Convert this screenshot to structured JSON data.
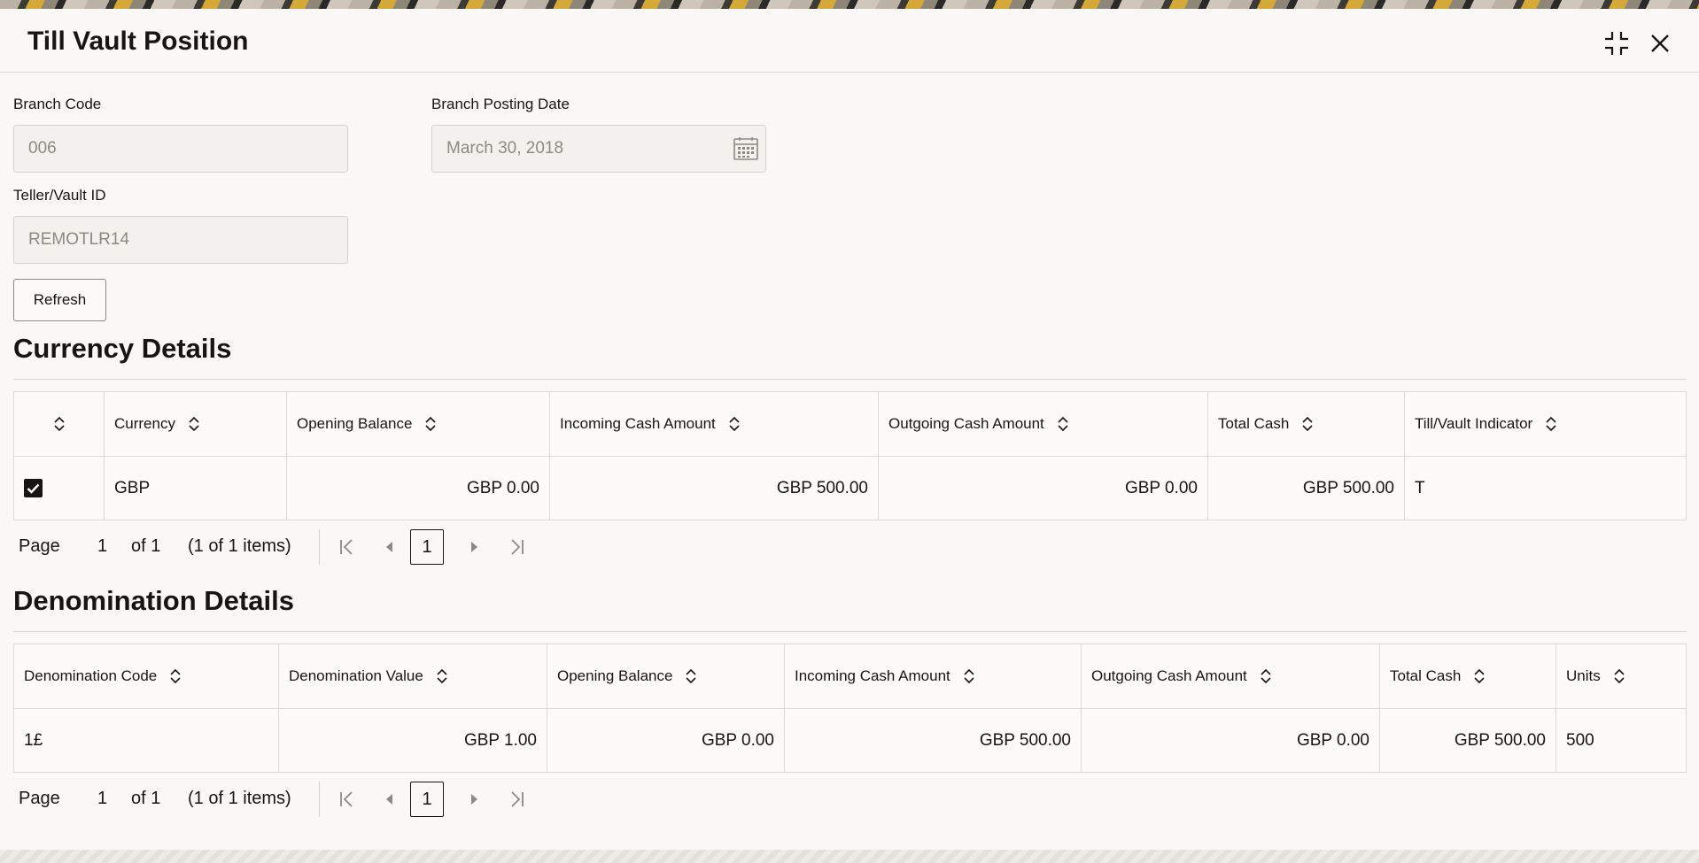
{
  "dialog": {
    "title": "Till Vault Position"
  },
  "form": {
    "branch_code": {
      "label": "Branch Code",
      "value": "006"
    },
    "branch_posting_date": {
      "label": "Branch Posting Date",
      "value": "March 30, 2018"
    },
    "teller_vault_id": {
      "label": "Teller/Vault ID",
      "value": "REMOTLR14"
    },
    "refresh_label": "Refresh"
  },
  "currency_details": {
    "title": "Currency Details",
    "columns": [
      "Currency",
      "Opening Balance",
      "Incoming Cash Amount",
      "Outgoing Cash Amount",
      "Total Cash",
      "Till/Vault Indicator"
    ],
    "rows": [
      {
        "selected": true,
        "currency": "GBP",
        "opening_balance": "GBP 0.00",
        "incoming": "GBP 500.00",
        "outgoing": "GBP 0.00",
        "total": "GBP 500.00",
        "indicator": "T"
      }
    ],
    "pager": {
      "page_label": "Page",
      "page": "1",
      "of": "of 1",
      "items": "(1 of 1 items)",
      "current": "1"
    }
  },
  "denomination_details": {
    "title": "Denomination Details",
    "columns": [
      "Denomination Code",
      "Denomination Value",
      "Opening Balance",
      "Incoming Cash Amount",
      "Outgoing Cash Amount",
      "Total Cash",
      "Units"
    ],
    "rows": [
      {
        "code": "1£",
        "value": "GBP 1.00",
        "opening_balance": "GBP 0.00",
        "incoming": "GBP 500.00",
        "outgoing": "GBP 0.00",
        "total": "GBP 500.00",
        "units": "500"
      }
    ],
    "pager": {
      "page_label": "Page",
      "page": "1",
      "of": "of 1",
      "items": "(1 of 1 items)",
      "current": "1"
    }
  }
}
